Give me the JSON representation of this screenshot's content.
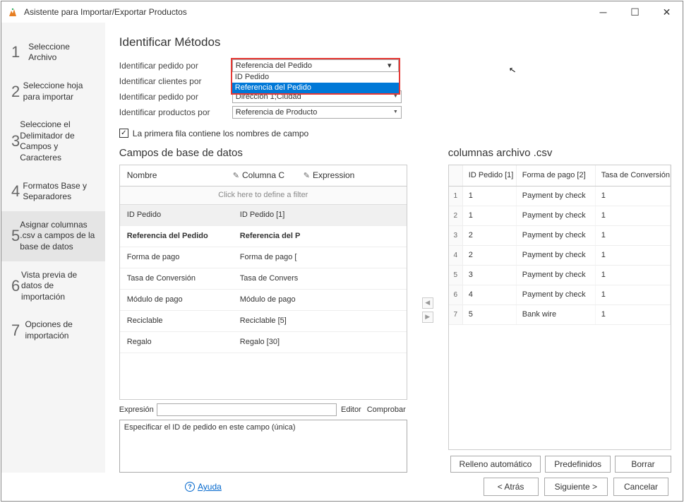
{
  "window": {
    "title": "Asistente para Importar/Exportar Productos"
  },
  "sidebar": {
    "items": [
      {
        "num": "1",
        "label": "Seleccione Archivo"
      },
      {
        "num": "2",
        "label": "Seleccione hoja para importar"
      },
      {
        "num": "3",
        "label": "Seleccione el Delimitador de Campos y Caracteres"
      },
      {
        "num": "4",
        "label": "Formatos Base y Separadores"
      },
      {
        "num": "5",
        "label": "Asignar columnas .csv a campos de la base de datos"
      },
      {
        "num": "6",
        "label": "Vista previa de datos de importación"
      },
      {
        "num": "7",
        "label": "Opciones de importación"
      }
    ]
  },
  "main": {
    "heading": "Identificar Métodos",
    "identify": [
      {
        "label": "Identificar pedido por",
        "value": "Referencia del Pedido"
      },
      {
        "label": "Identificar clientes por",
        "value": ""
      },
      {
        "label": "Identificar pedido por",
        "value": "Dirección 1;Ciudad"
      },
      {
        "label": "Identificar productos por",
        "value": "Referencia de Producto"
      }
    ],
    "dropdown": {
      "selected": "Referencia del Pedido",
      "options": [
        "ID Pedido",
        "Referencia del Pedido"
      ]
    },
    "checkbox_label": "La primera fila contiene los nombres de campo",
    "db_section_title": "Campos de base de datos",
    "csv_section_title": "columnas archivo .csv",
    "db_headers": {
      "name": "Nombre",
      "colc": "Columna C",
      "expr": "Expression"
    },
    "filter_text": "Click here to define a filter",
    "db_rows": [
      {
        "name": "ID Pedido",
        "col": "ID Pedido [1]",
        "selected": true
      },
      {
        "name": "Referencia del Pedido",
        "col": "Referencia del P",
        "bold": true
      },
      {
        "name": "Forma de pago",
        "col": "Forma de pago ["
      },
      {
        "name": "Tasa de Conversión",
        "col": "Tasa de Convers"
      },
      {
        "name": "Módulo de pago",
        "col": "Módulo de pago"
      },
      {
        "name": "Reciclable",
        "col": "Reciclable [5]"
      },
      {
        "name": "Regalo",
        "col": "Regalo [30]"
      }
    ],
    "expr_label": "Expresión",
    "expr_editor": "Editor",
    "expr_check": "Comprobar",
    "desc_text": "Especificar el ID de pedido en este campo (única)",
    "csv_headers": [
      "ID Pedido [1]",
      "Forma de pago [2]",
      "Tasa de Conversión"
    ],
    "csv_rows": [
      {
        "idx": "1",
        "id": "1",
        "pago": "Payment by check",
        "tasa": "1"
      },
      {
        "idx": "2",
        "id": "1",
        "pago": "Payment by check",
        "tasa": "1"
      },
      {
        "idx": "3",
        "id": "2",
        "pago": "Payment by check",
        "tasa": "1"
      },
      {
        "idx": "4",
        "id": "2",
        "pago": "Payment by check",
        "tasa": "1"
      },
      {
        "idx": "5",
        "id": "3",
        "pago": "Payment by check",
        "tasa": "1"
      },
      {
        "idx": "6",
        "id": "4",
        "pago": "Payment by check",
        "tasa": "1"
      },
      {
        "idx": "7",
        "id": "5",
        "pago": "Bank wire",
        "tasa": "1"
      }
    ],
    "csv_buttons": [
      "Relleno automático",
      "Predefinidos",
      "Borrar"
    ]
  },
  "footer": {
    "help": "Ayuda",
    "back": "< Atrás",
    "next": "Siguiente >",
    "cancel": "Cancelar"
  }
}
